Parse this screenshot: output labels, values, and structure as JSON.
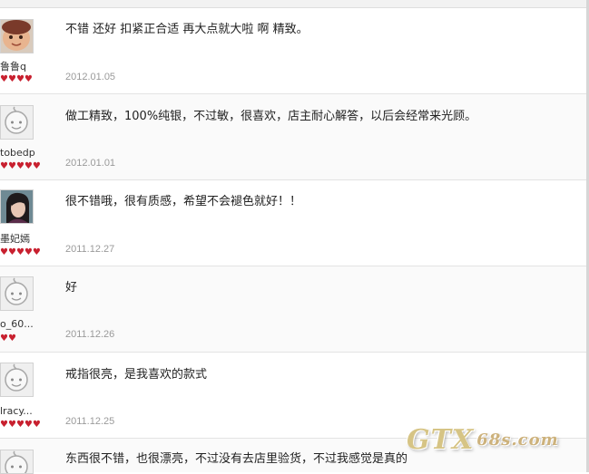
{
  "reviews": [
    {
      "user": "鲁鲁q",
      "comment": "不错 还好 扣紧正合适 再大点就大啦 啊 精致。",
      "date": "2012.01.05",
      "hearts": 4,
      "avatar": "photo-baby-avatar"
    },
    {
      "user": "tobedp",
      "comment": "做工精致，100%纯银，不过敏，很喜欢，店主耐心解答，以后会经常来光顾。",
      "date": "2012.01.01",
      "hearts": 5,
      "avatar": "default-face-avatar"
    },
    {
      "user": "墨妃嫣",
      "comment": "很不错哦，很有质感，希望不会褪色就好！！",
      "date": "2011.12.27",
      "hearts": 5,
      "avatar": "photo-girl-avatar"
    },
    {
      "user": "o_60...",
      "comment": "好",
      "date": "2011.12.26",
      "hearts": 2,
      "avatar": "default-face-avatar"
    },
    {
      "user": "lracy...",
      "comment": "戒指很亮，是我喜欢的款式",
      "date": "2011.12.25",
      "hearts": 5,
      "avatar": "default-face-avatar"
    },
    {
      "user": "",
      "comment": "东西很不错，也很漂亮，不过没有去店里验货，不过我感觉是真的",
      "date": "",
      "hearts": 0,
      "avatar": "default-face-avatar"
    }
  ],
  "watermark": {
    "main": "GTX",
    "suffix": "68s.com"
  },
  "colors": {
    "heart": "#c8202f",
    "date": "#9a9a9a",
    "divider": "#e3e3e3"
  }
}
